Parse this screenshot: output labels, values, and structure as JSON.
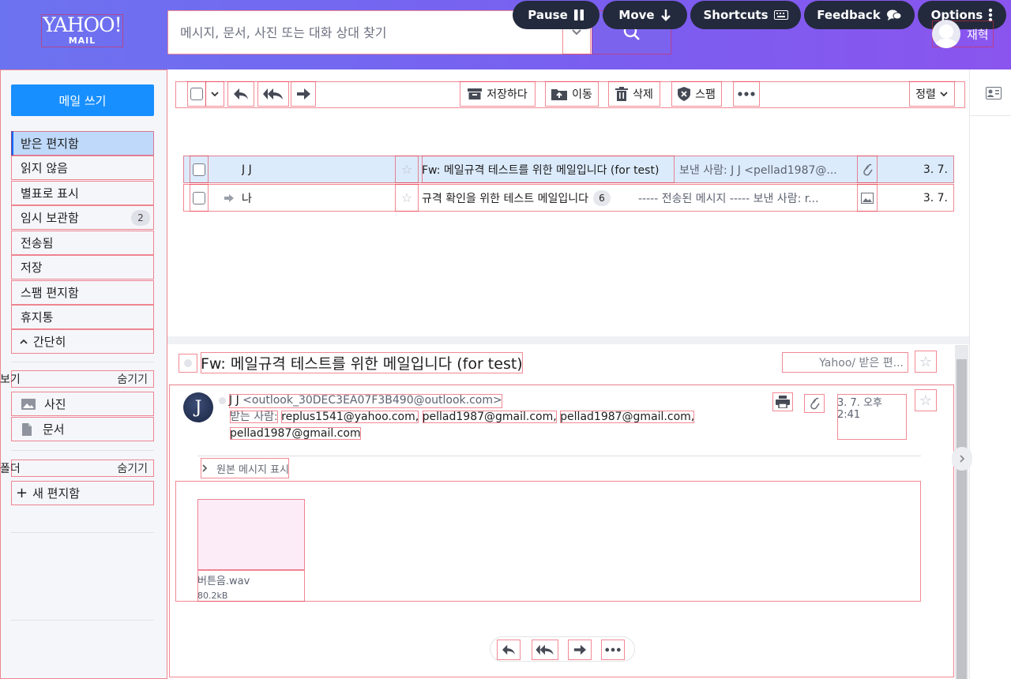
{
  "header": {
    "logo_line1": "YAHOO!",
    "logo_line2": "MAIL",
    "search_placeholder": "메시지, 문서, 사진 또는 대화 상대 찾기",
    "pills": [
      {
        "label": "Pause",
        "icon": "pause-icon"
      },
      {
        "label": "Move",
        "icon": "arrow-down-icon"
      },
      {
        "label": "Shortcuts",
        "icon": "keyboard-icon"
      },
      {
        "label": "Feedback",
        "icon": "chat-bubbles-icon"
      },
      {
        "label": "Options",
        "icon": "kebab-icon"
      }
    ],
    "user_name": "재혁"
  },
  "sidebar": {
    "compose_label": "메일 쓰기",
    "folders": [
      {
        "label": "받은 편지함",
        "active": true
      },
      {
        "label": "읽지 않음"
      },
      {
        "label": "별표로 표시"
      },
      {
        "label": "임시 보관함",
        "badge": "2"
      },
      {
        "label": "전송됨"
      },
      {
        "label": "저장"
      },
      {
        "label": "스팸 편지함"
      },
      {
        "label": "휴지통"
      }
    ],
    "collapse_label": "간단히",
    "view_section": {
      "title": "보기",
      "hide": "숨기기",
      "items": [
        "사진",
        "문서"
      ]
    },
    "folder_section": {
      "title": "폴더",
      "hide": "숨기기",
      "new_folder": "새 편지함"
    }
  },
  "toolbar": {
    "archive": "저장하다",
    "move": "이동",
    "delete": "삭제",
    "spam": "스팸",
    "sort": "정렬"
  },
  "messages": [
    {
      "sender": "J J",
      "subject": "Fw: 메일규격 테스트를 위한 메일입니다 (for test)",
      "preview": "보낸 사람: J J <pellad1987@...",
      "date": "3. 7.",
      "icon": "paperclip-icon",
      "selected": true
    },
    {
      "sender": "나",
      "subject": "규격 확인을 위한 테스트 메일입니다",
      "count": "6",
      "preview": "----- 전송된 메시지 ----- 보낸 사람: r...",
      "date": "3. 7.",
      "icon": "image-icon",
      "selected": false
    }
  ],
  "reading": {
    "subject": "Fw: 메일규격 테스트를 위한 메일입니다 (for test)",
    "folder_path": "Yahoo/ 받은 편...",
    "sender_initial": "J",
    "sender_name": "J J",
    "sender_email": "<outlook_30DEC3EA07F3B490@outlook.com>",
    "to_label": "받는 사람:",
    "recipients": [
      "replus1541@yahoo.com,",
      "pellad1987@gmail.com,",
      "pellad1987@gmail.com,",
      "pellad1987@gmail.com"
    ],
    "date": "3. 7. 오후 2:41",
    "show_original": "원본 메시지 표시",
    "attachment_name": "버튼음.wav",
    "attachment_size": "80.2kB"
  },
  "colors": {
    "accent": "#188fff",
    "header_start": "#6c73f0",
    "header_end": "#8a55ee",
    "active_folder": "#bfd9fa",
    "selected_row": "#dcebfb"
  }
}
